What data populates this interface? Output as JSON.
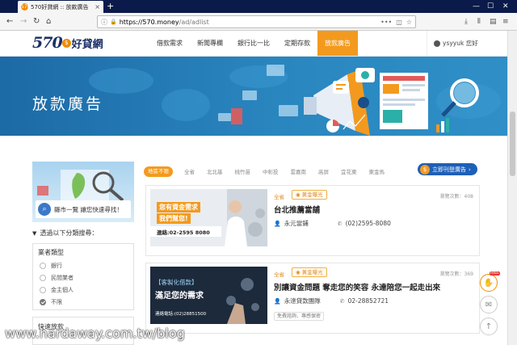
{
  "browser": {
    "tab_title": "570好貸網 :: 放款廣告",
    "tab_favicon": "570",
    "url_host": "https://570.money",
    "url_path": "/ad/adlist"
  },
  "site": {
    "logo_num": "570",
    "logo_brand": "好貸網",
    "nav": [
      "借款需求",
      "新聞專欄",
      "銀行比一比",
      "定期存款",
      "放款廣告"
    ],
    "active_nav": 4,
    "user_name": "ysyyuk",
    "user_greeting": "您好"
  },
  "banner": {
    "title": "放款廣告"
  },
  "sidebar": {
    "promo_search": "縣市一覽 讓您快速尋找！",
    "filter_title": "透過以下分類搜尋：",
    "filter_group": "業者類型",
    "options": [
      "銀行",
      "民間業者",
      "金主個人",
      "不限"
    ],
    "checked_option": 3,
    "second_group": "快速放款"
  },
  "regions": {
    "items": [
      "地區不限",
      "全省",
      "北北基",
      "桃竹苗",
      "中彰投",
      "雲嘉南",
      "高屏",
      "宜花東",
      "東金馬"
    ],
    "active": 0,
    "post_button": "立即刊登廣告"
  },
  "listings": [
    {
      "location": "全省",
      "badge": "黃金曝光",
      "views": "瀏覽次數：408",
      "title": "台北推薦當舖",
      "company": "永元當鋪",
      "phone": "(02)2595-8080",
      "thumb_line1": "您有資金需求",
      "thumb_line2": "我們幫您!",
      "thumb_phone": "連絡:02-2595 8080"
    },
    {
      "location": "全省",
      "badge": "黃金曝光",
      "views": "瀏覽次數：369",
      "title": "別讓資金問題 奪走您的笑容 永達陪您一起走出來",
      "company": "永達貸款團隊",
      "phone": "02-28852721",
      "tag": "免費諮詢．專感保密",
      "thumb_line1": "【客製化借款】",
      "thumb_line2": "滿足您的需求",
      "thumb_phone": "連絡電話:(02)28851500"
    }
  ],
  "fab_free": "FREE",
  "watermark": "www.hardaway.com.tw/blog",
  "colors": {
    "accent_orange": "#f39a1e",
    "brand_navy": "#1a2f66",
    "banner_blue": "#2a86bf",
    "post_blue": "#1e5fb8"
  }
}
